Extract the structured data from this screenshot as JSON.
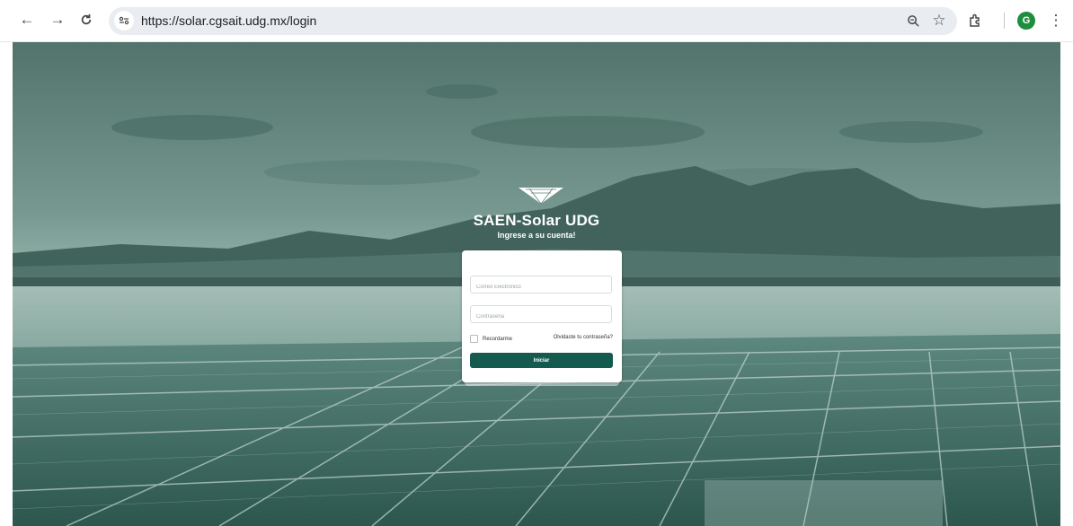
{
  "browser": {
    "url": "https://solar.cgsait.udg.mx/login",
    "back_icon": "arrow-left-icon",
    "forward_icon": "arrow-right-icon",
    "reload_icon": "reload-icon",
    "profile_initial": "G",
    "profile_color": "#1e8e3e"
  },
  "login": {
    "title": "SAEN-Solar UDG",
    "subtitle": "Ingrese a su cuenta!",
    "email_placeholder": "Correo Electrónico",
    "password_placeholder": "Contraseña",
    "remember_label": "Recordarme",
    "forgot_link": "Olvidaste tu contraseña?",
    "submit_label": "Iniciar"
  },
  "colors": {
    "accent": "#145a4f",
    "overlay": "#5d8278"
  }
}
